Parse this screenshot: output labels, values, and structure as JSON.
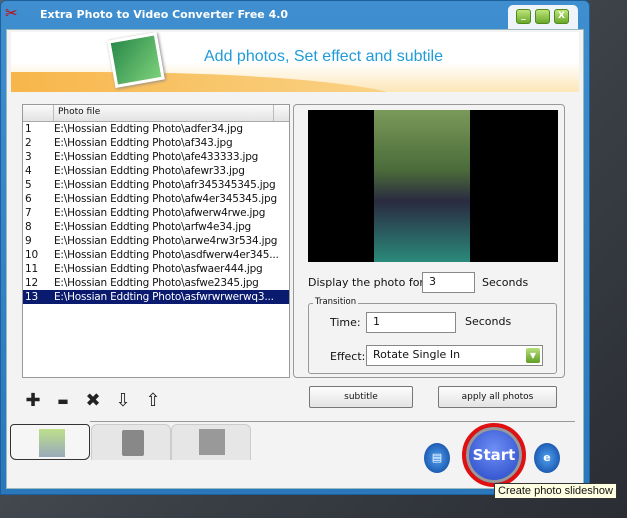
{
  "window": {
    "title": "Extra Photo to Video Converter Free 4.0",
    "minimize": "_",
    "close": "X"
  },
  "banner": {
    "heading": "Add photos, Set effect and subtile"
  },
  "list": {
    "columns": [
      "",
      "Photo file"
    ],
    "rows": [
      {
        "n": "1",
        "file": "E:\\Hossian Eddting Photo\\adfer34.jpg"
      },
      {
        "n": "2",
        "file": "E:\\Hossian Eddting Photo\\af343.jpg"
      },
      {
        "n": "3",
        "file": "E:\\Hossian Eddting Photo\\afe433333.jpg"
      },
      {
        "n": "4",
        "file": "E:\\Hossian Eddting Photo\\afewr33.jpg"
      },
      {
        "n": "5",
        "file": "E:\\Hossian Eddting Photo\\afr345345345.jpg"
      },
      {
        "n": "6",
        "file": "E:\\Hossian Eddting Photo\\afw4er345345.jpg"
      },
      {
        "n": "7",
        "file": "E:\\Hossian Eddting Photo\\afwerw4rwe.jpg"
      },
      {
        "n": "8",
        "file": "E:\\Hossian Eddting Photo\\arfw4e34.jpg"
      },
      {
        "n": "9",
        "file": "E:\\Hossian Eddting Photo\\arwe4rw3r534.jpg"
      },
      {
        "n": "10",
        "file": "E:\\Hossian Eddting Photo\\asdfwerw4er345..."
      },
      {
        "n": "11",
        "file": "E:\\Hossian Eddting Photo\\asfwaer444.jpg"
      },
      {
        "n": "12",
        "file": "E:\\Hossian Eddting Photo\\asfwe2345.jpg"
      },
      {
        "n": "13",
        "file": "E:\\Hossian Eddting Photo\\asfwrwrwerwq3...",
        "selected": true
      }
    ]
  },
  "settings": {
    "display_label": "Display the photo for",
    "display_value": "3",
    "seconds": "Seconds",
    "transition_label": "Transition",
    "time_label": "Time:",
    "time_value": "1",
    "effect_label": "Effect:",
    "effect_value": "Rotate Single In"
  },
  "toolbar": {
    "add": "✚",
    "remove": "▬",
    "clear": "✖",
    "down": "⇩",
    "up": "⇧"
  },
  "buttons": {
    "subtitle": "subtitle",
    "apply": "apply  all photos",
    "start": "Start"
  },
  "tooltip": "Create photo slideshow"
}
